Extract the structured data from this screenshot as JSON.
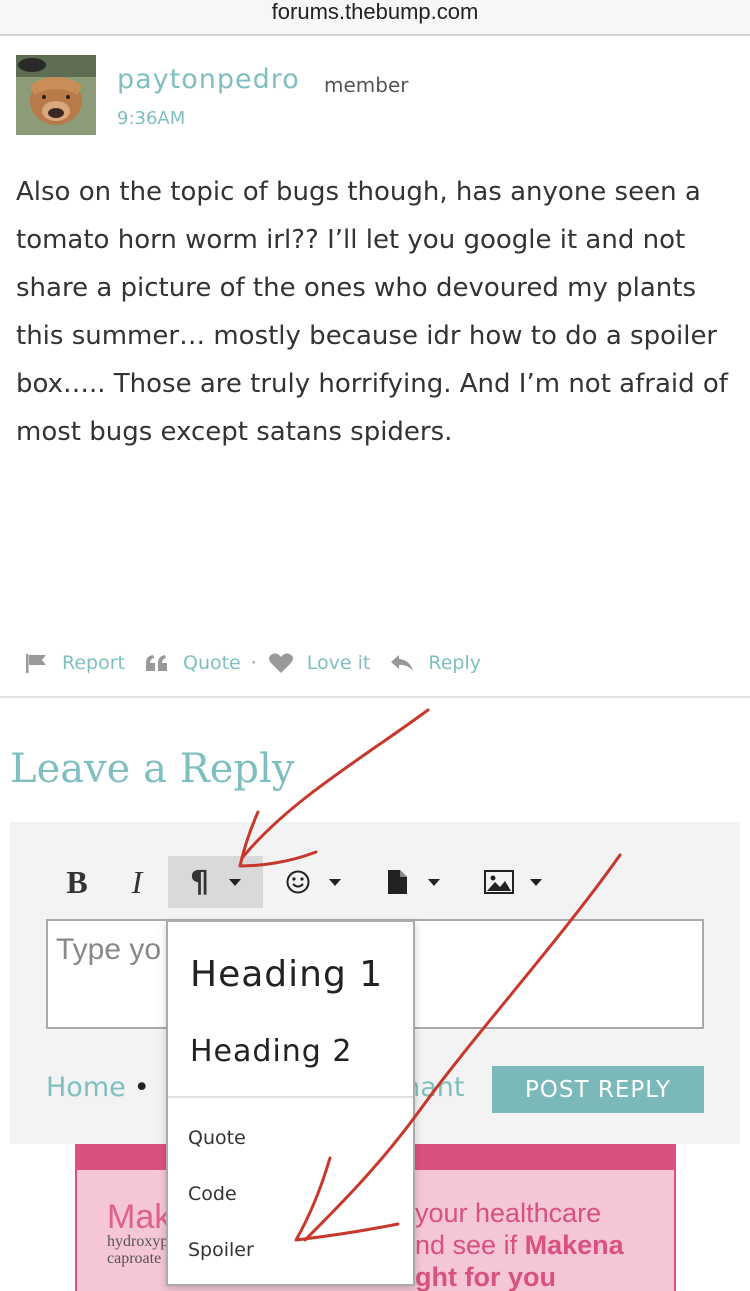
{
  "browser": {
    "url": "forums.thebump.com"
  },
  "post": {
    "username": "paytonpedro",
    "role": "member",
    "timestamp": "9:36AM",
    "avatar_icon": "highland-cow-avatar",
    "body": "Also on the topic of bugs though, has anyone seen a tomato horn worm irl?? I’ll let you google it and not share a picture of the ones who devoured my plants this summer… mostly because idr how to do a spoiler box….. Those are truly horrifying. And I’m not afraid of most bugs except satans spiders."
  },
  "actions": {
    "report": "Report",
    "quote": "Quote",
    "separator": "·",
    "love": "Love it",
    "reply": "Reply"
  },
  "reply_form": {
    "title": "Leave a Reply",
    "toolbar": {
      "bold": "B",
      "italic": "I",
      "paragraph": "¶",
      "emoji_icon": "smiley-icon",
      "file_icon": "document-icon",
      "image_icon": "image-icon"
    },
    "textarea_placeholder": "Type yo",
    "breadcrumb_home": "Home",
    "breadcrumb_dot": "•",
    "breadcrumb_partial": "gnant",
    "post_button": "POST REPLY"
  },
  "format_menu": {
    "heading1": "Heading 1",
    "heading2": "Heading 2",
    "quote": "Quote",
    "code": "Code",
    "spoiler": "Spoiler"
  },
  "ad": {
    "brand": "Mak",
    "sub1": "hydroxypr",
    "sub2": "caproate i",
    "line1": "your healthcare",
    "line2_prefix": "nd see if ",
    "line2_bold": "Makena",
    "line3": "ght for you"
  },
  "colors": {
    "accent": "#7fbfc0",
    "button": "#7ab8ba",
    "ad_pink": "#d9517e",
    "ad_bg": "#f4c6d6",
    "annotation": "#c8372b"
  }
}
